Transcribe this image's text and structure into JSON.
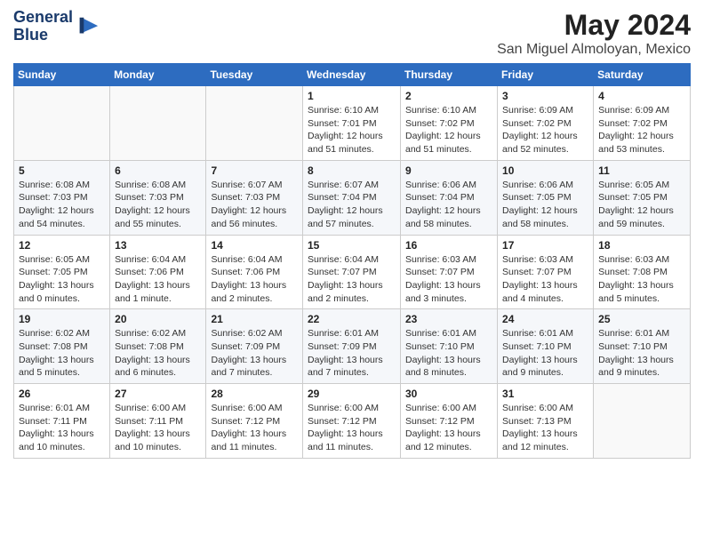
{
  "logo": {
    "line1": "General",
    "line2": "Blue"
  },
  "title": "May 2024",
  "subtitle": "San Miguel Almoloyan, Mexico",
  "days_header": [
    "Sunday",
    "Monday",
    "Tuesday",
    "Wednesday",
    "Thursday",
    "Friday",
    "Saturday"
  ],
  "weeks": [
    [
      {
        "num": "",
        "info": ""
      },
      {
        "num": "",
        "info": ""
      },
      {
        "num": "",
        "info": ""
      },
      {
        "num": "1",
        "info": "Sunrise: 6:10 AM\nSunset: 7:01 PM\nDaylight: 12 hours and 51 minutes."
      },
      {
        "num": "2",
        "info": "Sunrise: 6:10 AM\nSunset: 7:02 PM\nDaylight: 12 hours and 51 minutes."
      },
      {
        "num": "3",
        "info": "Sunrise: 6:09 AM\nSunset: 7:02 PM\nDaylight: 12 hours and 52 minutes."
      },
      {
        "num": "4",
        "info": "Sunrise: 6:09 AM\nSunset: 7:02 PM\nDaylight: 12 hours and 53 minutes."
      }
    ],
    [
      {
        "num": "5",
        "info": "Sunrise: 6:08 AM\nSunset: 7:03 PM\nDaylight: 12 hours and 54 minutes."
      },
      {
        "num": "6",
        "info": "Sunrise: 6:08 AM\nSunset: 7:03 PM\nDaylight: 12 hours and 55 minutes."
      },
      {
        "num": "7",
        "info": "Sunrise: 6:07 AM\nSunset: 7:03 PM\nDaylight: 12 hours and 56 minutes."
      },
      {
        "num": "8",
        "info": "Sunrise: 6:07 AM\nSunset: 7:04 PM\nDaylight: 12 hours and 57 minutes."
      },
      {
        "num": "9",
        "info": "Sunrise: 6:06 AM\nSunset: 7:04 PM\nDaylight: 12 hours and 58 minutes."
      },
      {
        "num": "10",
        "info": "Sunrise: 6:06 AM\nSunset: 7:05 PM\nDaylight: 12 hours and 58 minutes."
      },
      {
        "num": "11",
        "info": "Sunrise: 6:05 AM\nSunset: 7:05 PM\nDaylight: 12 hours and 59 minutes."
      }
    ],
    [
      {
        "num": "12",
        "info": "Sunrise: 6:05 AM\nSunset: 7:05 PM\nDaylight: 13 hours and 0 minutes."
      },
      {
        "num": "13",
        "info": "Sunrise: 6:04 AM\nSunset: 7:06 PM\nDaylight: 13 hours and 1 minute."
      },
      {
        "num": "14",
        "info": "Sunrise: 6:04 AM\nSunset: 7:06 PM\nDaylight: 13 hours and 2 minutes."
      },
      {
        "num": "15",
        "info": "Sunrise: 6:04 AM\nSunset: 7:07 PM\nDaylight: 13 hours and 2 minutes."
      },
      {
        "num": "16",
        "info": "Sunrise: 6:03 AM\nSunset: 7:07 PM\nDaylight: 13 hours and 3 minutes."
      },
      {
        "num": "17",
        "info": "Sunrise: 6:03 AM\nSunset: 7:07 PM\nDaylight: 13 hours and 4 minutes."
      },
      {
        "num": "18",
        "info": "Sunrise: 6:03 AM\nSunset: 7:08 PM\nDaylight: 13 hours and 5 minutes."
      }
    ],
    [
      {
        "num": "19",
        "info": "Sunrise: 6:02 AM\nSunset: 7:08 PM\nDaylight: 13 hours and 5 minutes."
      },
      {
        "num": "20",
        "info": "Sunrise: 6:02 AM\nSunset: 7:08 PM\nDaylight: 13 hours and 6 minutes."
      },
      {
        "num": "21",
        "info": "Sunrise: 6:02 AM\nSunset: 7:09 PM\nDaylight: 13 hours and 7 minutes."
      },
      {
        "num": "22",
        "info": "Sunrise: 6:01 AM\nSunset: 7:09 PM\nDaylight: 13 hours and 7 minutes."
      },
      {
        "num": "23",
        "info": "Sunrise: 6:01 AM\nSunset: 7:10 PM\nDaylight: 13 hours and 8 minutes."
      },
      {
        "num": "24",
        "info": "Sunrise: 6:01 AM\nSunset: 7:10 PM\nDaylight: 13 hours and 9 minutes."
      },
      {
        "num": "25",
        "info": "Sunrise: 6:01 AM\nSunset: 7:10 PM\nDaylight: 13 hours and 9 minutes."
      }
    ],
    [
      {
        "num": "26",
        "info": "Sunrise: 6:01 AM\nSunset: 7:11 PM\nDaylight: 13 hours and 10 minutes."
      },
      {
        "num": "27",
        "info": "Sunrise: 6:00 AM\nSunset: 7:11 PM\nDaylight: 13 hours and 10 minutes."
      },
      {
        "num": "28",
        "info": "Sunrise: 6:00 AM\nSunset: 7:12 PM\nDaylight: 13 hours and 11 minutes."
      },
      {
        "num": "29",
        "info": "Sunrise: 6:00 AM\nSunset: 7:12 PM\nDaylight: 13 hours and 11 minutes."
      },
      {
        "num": "30",
        "info": "Sunrise: 6:00 AM\nSunset: 7:12 PM\nDaylight: 13 hours and 12 minutes."
      },
      {
        "num": "31",
        "info": "Sunrise: 6:00 AM\nSunset: 7:13 PM\nDaylight: 13 hours and 12 minutes."
      },
      {
        "num": "",
        "info": ""
      }
    ]
  ]
}
